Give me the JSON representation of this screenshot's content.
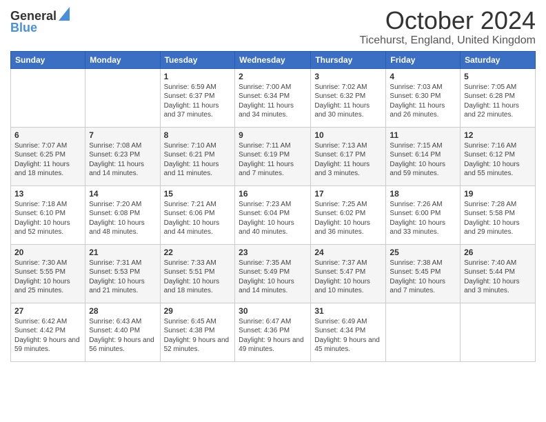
{
  "header": {
    "logo_general": "General",
    "logo_blue": "Blue",
    "month": "October 2024",
    "location": "Ticehurst, England, United Kingdom"
  },
  "days_of_week": [
    "Sunday",
    "Monday",
    "Tuesday",
    "Wednesday",
    "Thursday",
    "Friday",
    "Saturday"
  ],
  "weeks": [
    [
      {
        "day": "",
        "info": ""
      },
      {
        "day": "",
        "info": ""
      },
      {
        "day": "1",
        "info": "Sunrise: 6:59 AM\nSunset: 6:37 PM\nDaylight: 11 hours and 37 minutes."
      },
      {
        "day": "2",
        "info": "Sunrise: 7:00 AM\nSunset: 6:34 PM\nDaylight: 11 hours and 34 minutes."
      },
      {
        "day": "3",
        "info": "Sunrise: 7:02 AM\nSunset: 6:32 PM\nDaylight: 11 hours and 30 minutes."
      },
      {
        "day": "4",
        "info": "Sunrise: 7:03 AM\nSunset: 6:30 PM\nDaylight: 11 hours and 26 minutes."
      },
      {
        "day": "5",
        "info": "Sunrise: 7:05 AM\nSunset: 6:28 PM\nDaylight: 11 hours and 22 minutes."
      }
    ],
    [
      {
        "day": "6",
        "info": "Sunrise: 7:07 AM\nSunset: 6:25 PM\nDaylight: 11 hours and 18 minutes."
      },
      {
        "day": "7",
        "info": "Sunrise: 7:08 AM\nSunset: 6:23 PM\nDaylight: 11 hours and 14 minutes."
      },
      {
        "day": "8",
        "info": "Sunrise: 7:10 AM\nSunset: 6:21 PM\nDaylight: 11 hours and 11 minutes."
      },
      {
        "day": "9",
        "info": "Sunrise: 7:11 AM\nSunset: 6:19 PM\nDaylight: 11 hours and 7 minutes."
      },
      {
        "day": "10",
        "info": "Sunrise: 7:13 AM\nSunset: 6:17 PM\nDaylight: 11 hours and 3 minutes."
      },
      {
        "day": "11",
        "info": "Sunrise: 7:15 AM\nSunset: 6:14 PM\nDaylight: 10 hours and 59 minutes."
      },
      {
        "day": "12",
        "info": "Sunrise: 7:16 AM\nSunset: 6:12 PM\nDaylight: 10 hours and 55 minutes."
      }
    ],
    [
      {
        "day": "13",
        "info": "Sunrise: 7:18 AM\nSunset: 6:10 PM\nDaylight: 10 hours and 52 minutes."
      },
      {
        "day": "14",
        "info": "Sunrise: 7:20 AM\nSunset: 6:08 PM\nDaylight: 10 hours and 48 minutes."
      },
      {
        "day": "15",
        "info": "Sunrise: 7:21 AM\nSunset: 6:06 PM\nDaylight: 10 hours and 44 minutes."
      },
      {
        "day": "16",
        "info": "Sunrise: 7:23 AM\nSunset: 6:04 PM\nDaylight: 10 hours and 40 minutes."
      },
      {
        "day": "17",
        "info": "Sunrise: 7:25 AM\nSunset: 6:02 PM\nDaylight: 10 hours and 36 minutes."
      },
      {
        "day": "18",
        "info": "Sunrise: 7:26 AM\nSunset: 6:00 PM\nDaylight: 10 hours and 33 minutes."
      },
      {
        "day": "19",
        "info": "Sunrise: 7:28 AM\nSunset: 5:58 PM\nDaylight: 10 hours and 29 minutes."
      }
    ],
    [
      {
        "day": "20",
        "info": "Sunrise: 7:30 AM\nSunset: 5:55 PM\nDaylight: 10 hours and 25 minutes."
      },
      {
        "day": "21",
        "info": "Sunrise: 7:31 AM\nSunset: 5:53 PM\nDaylight: 10 hours and 21 minutes."
      },
      {
        "day": "22",
        "info": "Sunrise: 7:33 AM\nSunset: 5:51 PM\nDaylight: 10 hours and 18 minutes."
      },
      {
        "day": "23",
        "info": "Sunrise: 7:35 AM\nSunset: 5:49 PM\nDaylight: 10 hours and 14 minutes."
      },
      {
        "day": "24",
        "info": "Sunrise: 7:37 AM\nSunset: 5:47 PM\nDaylight: 10 hours and 10 minutes."
      },
      {
        "day": "25",
        "info": "Sunrise: 7:38 AM\nSunset: 5:45 PM\nDaylight: 10 hours and 7 minutes."
      },
      {
        "day": "26",
        "info": "Sunrise: 7:40 AM\nSunset: 5:44 PM\nDaylight: 10 hours and 3 minutes."
      }
    ],
    [
      {
        "day": "27",
        "info": "Sunrise: 6:42 AM\nSunset: 4:42 PM\nDaylight: 9 hours and 59 minutes."
      },
      {
        "day": "28",
        "info": "Sunrise: 6:43 AM\nSunset: 4:40 PM\nDaylight: 9 hours and 56 minutes."
      },
      {
        "day": "29",
        "info": "Sunrise: 6:45 AM\nSunset: 4:38 PM\nDaylight: 9 hours and 52 minutes."
      },
      {
        "day": "30",
        "info": "Sunrise: 6:47 AM\nSunset: 4:36 PM\nDaylight: 9 hours and 49 minutes."
      },
      {
        "day": "31",
        "info": "Sunrise: 6:49 AM\nSunset: 4:34 PM\nDaylight: 9 hours and 45 minutes."
      },
      {
        "day": "",
        "info": ""
      },
      {
        "day": "",
        "info": ""
      }
    ]
  ]
}
